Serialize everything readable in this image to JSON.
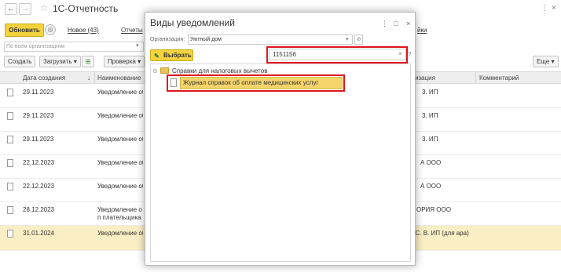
{
  "app": {
    "title": "1С-Отчетность",
    "back": "←",
    "forward": "→",
    "star": "☆",
    "menu": "⋮",
    "close": "×"
  },
  "tabbar": {
    "refresh_label": "Обновить",
    "settings_glyph": "◎",
    "new_label": "Новое (43)",
    "reports_label": "Отчеты",
    "right_label": "йки"
  },
  "filter": {
    "placeholder": "По всем организациям",
    "arrow": "▾"
  },
  "toolbar": {
    "create_label": "Создать",
    "load_label": "Загрузить",
    "load_arrow": "▾",
    "excel_glyph": "⊞",
    "check_label": "Проверка",
    "check_arrow": "▾",
    "more_label": "Еще",
    "more_arrow": "▾"
  },
  "grid": {
    "col_date": "Дата создания",
    "sort_arrow": "↓",
    "col_name": "Наименование",
    "col_org": "изация",
    "col_comment": "Комментарий",
    "rows": [
      {
        "date": "29.11.2023",
        "name": "Уведомление об",
        "org": "3. ИП",
        "selected": false
      },
      {
        "date": "29.11.2023",
        "name": "Уведомление об",
        "org": "3. ИП",
        "selected": false
      },
      {
        "date": "29.11.2023",
        "name": "Уведомление об",
        "org": "3. ИП",
        "selected": false
      },
      {
        "date": "22.12.2023",
        "name": "Уведомление об",
        "org": "А ООО",
        "selected": false
      },
      {
        "date": "22.12.2023",
        "name": "Уведомление об",
        "org": "А ООО",
        "selected": false
      },
      {
        "date": "28.12.2023",
        "name": "Уведомление о п плательщика тор",
        "org": "ОРИЯ ООО",
        "selected": false
      },
      {
        "date": "31.01.2024",
        "name": "Уведомление об",
        "org": "в С. В. ИП (для ара)",
        "selected": true
      }
    ]
  },
  "dialog": {
    "title": "Виды уведомлений",
    "menu": "⋮",
    "maximize": "□",
    "close": "×",
    "org_label": "Организация:",
    "org_value": "Уютный дом",
    "org_dropdown": "▾",
    "org_link": "⊘",
    "select_label": "Выбрать",
    "select_glyph": "✎",
    "search_value": "1151156",
    "search_clear": "×",
    "help": "?",
    "tree_group": "Справки для налоговых вычетов",
    "tree_toggle": "⊖",
    "tree_item": "Журнал справок об оплате медицинских услуг"
  },
  "colors": {
    "accent_yellow": "#f5d33d",
    "highlight_red": "#e0141e",
    "selected_row": "#f9eec4"
  }
}
